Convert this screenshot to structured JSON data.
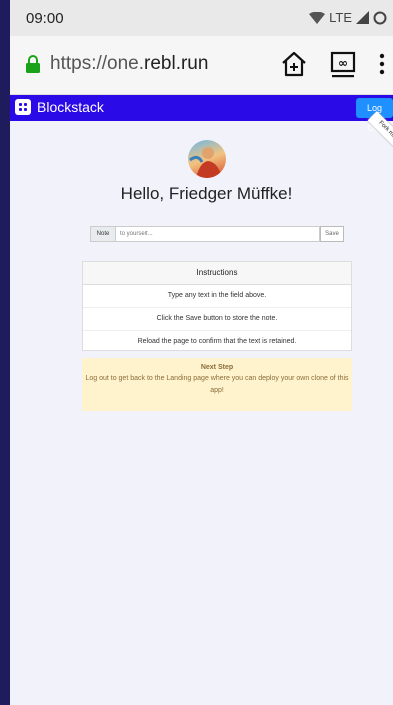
{
  "status_bar": {
    "time": "09:00",
    "network": "LTE"
  },
  "browser": {
    "url_prefix": "https://one.",
    "url_domain": "rebl.run",
    "icons": [
      "lock-icon",
      "home-plus-icon",
      "tab-switcher-icon",
      "overflow-menu-icon"
    ]
  },
  "navbar": {
    "brand": "Blockstack",
    "logout_label": "Log Out",
    "color": "#2a0ae6"
  },
  "ribbon": {
    "label": "Fork me on GitHub"
  },
  "greeting": "Hello, Friedger Müffke!",
  "note": {
    "label": "Note",
    "placeholder": "to yourself...",
    "save_label": "Save"
  },
  "instructions": {
    "title": "Instructions",
    "steps": [
      "Type any text in the field above.",
      "Click the Save button to store the note.",
      "Reload the page to confirm that the text is retained."
    ]
  },
  "next_step": {
    "title": "Next Step",
    "body": "Log out to get back to the Landing page where you can deploy your own clone of this app!"
  }
}
